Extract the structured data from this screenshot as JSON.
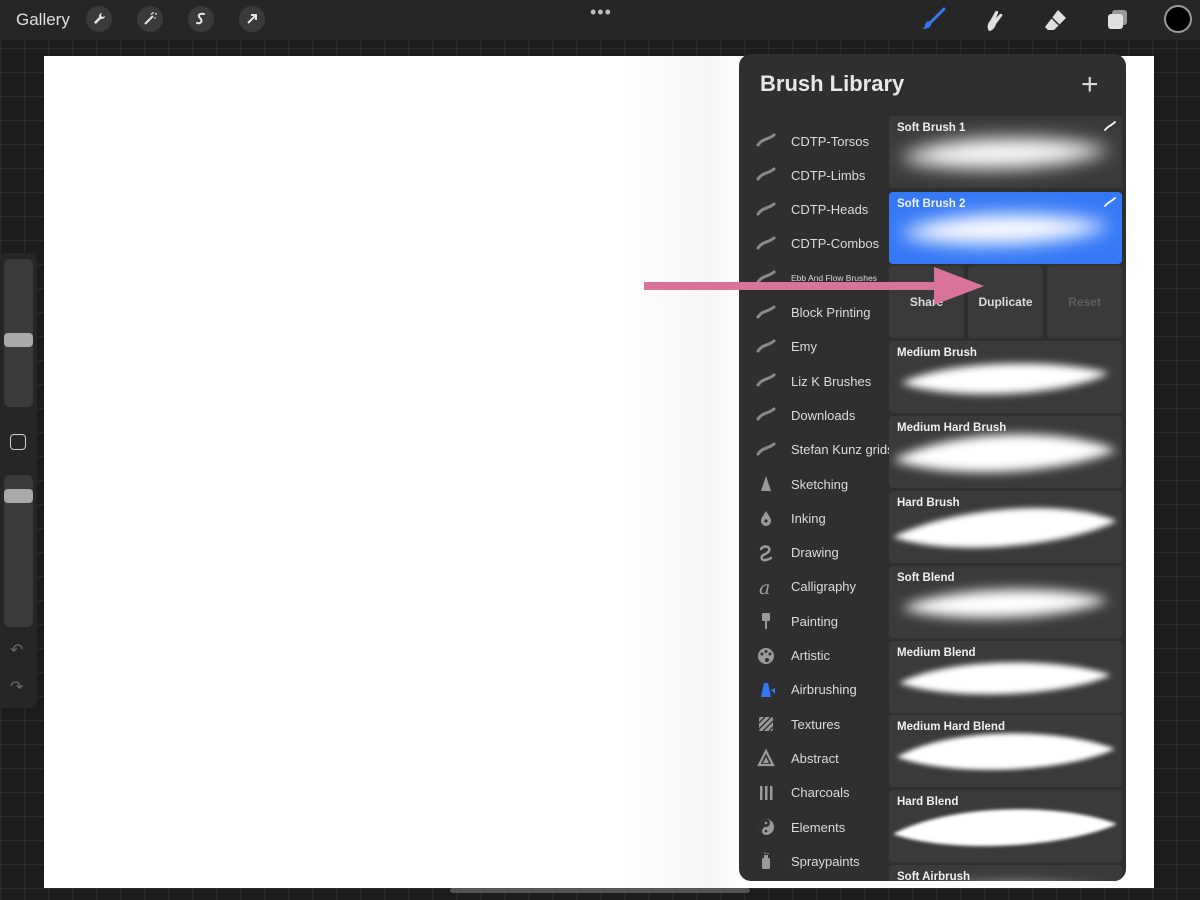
{
  "topbar": {
    "gallery_label": "Gallery",
    "tools": [
      "wrench-icon",
      "magic-wand-icon",
      "selection-icon",
      "transform-arrow-icon"
    ],
    "more_dots": "•••",
    "right_tools": [
      "brush-icon",
      "smudge-icon",
      "eraser-icon",
      "layers-icon"
    ],
    "active_tool": "brush",
    "current_color": "#000000"
  },
  "sidebar": {
    "brush_size_level": 0.45,
    "opacity_level": 0.1,
    "undo": "↶",
    "redo": "↷"
  },
  "panel": {
    "title": "Brush Library",
    "add_label": "+",
    "brush_sets": [
      {
        "label": "CDTP-Torsos",
        "icon": "imported-brush-icon"
      },
      {
        "label": "CDTP-Limbs",
        "icon": "imported-brush-icon"
      },
      {
        "label": "CDTP-Heads",
        "icon": "imported-brush-icon"
      },
      {
        "label": "CDTP-Combos",
        "icon": "imported-brush-icon"
      },
      {
        "label": "Ebb And Flow Brushes",
        "icon": "imported-brush-icon"
      },
      {
        "label": "Block Printing",
        "icon": "imported-brush-icon"
      },
      {
        "label": "Emy",
        "icon": "imported-brush-icon"
      },
      {
        "label": "Liz K Brushes",
        "icon": "imported-brush-icon"
      },
      {
        "label": "Downloads",
        "icon": "imported-brush-icon"
      },
      {
        "label": "Stefan Kunz grids",
        "icon": "imported-brush-icon"
      },
      {
        "label": "Sketching",
        "icon": "pencil-tip-icon"
      },
      {
        "label": "Inking",
        "icon": "ink-drop-icon"
      },
      {
        "label": "Drawing",
        "icon": "squiggle-icon"
      },
      {
        "label": "Calligraphy",
        "icon": "calligraphy-a-icon"
      },
      {
        "label": "Painting",
        "icon": "paintbrush-icon"
      },
      {
        "label": "Artistic",
        "icon": "palette-icon"
      },
      {
        "label": "Airbrushing",
        "icon": "airbrush-icon"
      },
      {
        "label": "Textures",
        "icon": "texture-icon"
      },
      {
        "label": "Abstract",
        "icon": "triangle-icon"
      },
      {
        "label": "Charcoals",
        "icon": "charcoal-sticks-icon"
      },
      {
        "label": "Elements",
        "icon": "yin-yang-icon"
      },
      {
        "label": "Spraypaints",
        "icon": "spray-can-icon"
      }
    ],
    "active_set": "Airbrushing",
    "brushes": [
      {
        "name": "Soft Brush 1",
        "selected": false
      },
      {
        "name": "Soft Brush 2",
        "selected": true
      },
      {
        "name": "Medium Brush",
        "selected": false
      },
      {
        "name": "Medium Hard Brush",
        "selected": false
      },
      {
        "name": "Hard Brush",
        "selected": false
      },
      {
        "name": "Soft Blend",
        "selected": false
      },
      {
        "name": "Medium Blend",
        "selected": false
      },
      {
        "name": "Medium Hard Blend",
        "selected": false
      },
      {
        "name": "Hard Blend",
        "selected": false
      },
      {
        "name": "Soft Airbrush",
        "selected": false
      }
    ],
    "actions": {
      "share": "Share",
      "duplicate": "Duplicate",
      "reset": "Reset"
    }
  },
  "colors": {
    "accent": "#3478f6",
    "arrow": "#d9739a",
    "panel_bg": "#2f2f2f"
  }
}
